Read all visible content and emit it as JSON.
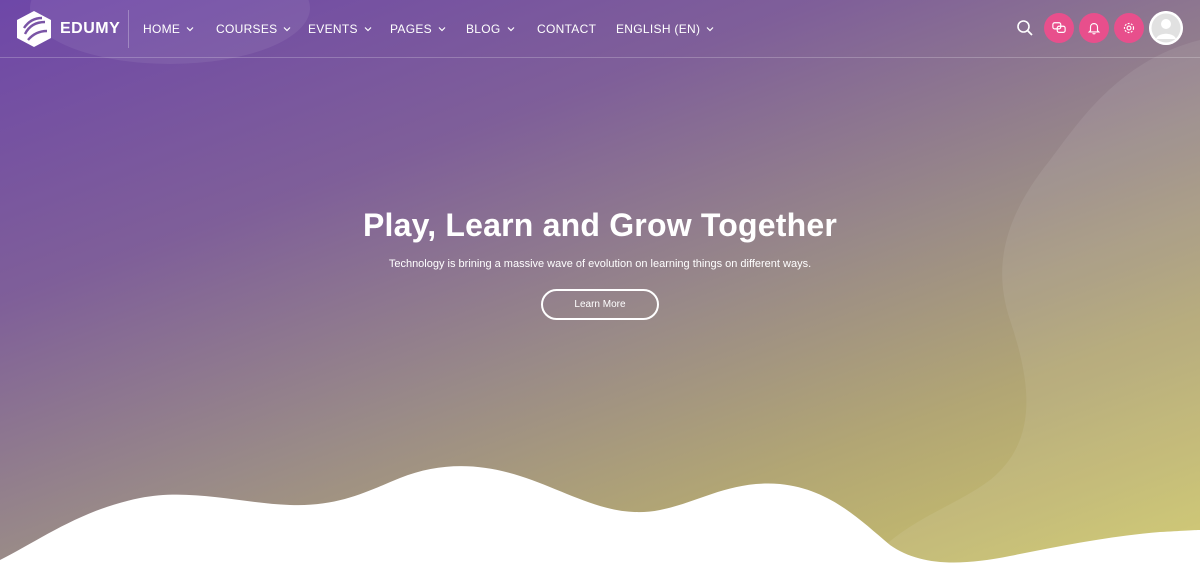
{
  "brand": {
    "name": "EDUMY"
  },
  "nav": {
    "items": [
      {
        "label": "HOME",
        "has_dropdown": true
      },
      {
        "label": "COURSES",
        "has_dropdown": true
      },
      {
        "label": "EVENTS",
        "has_dropdown": true
      },
      {
        "label": "PAGES",
        "has_dropdown": true
      },
      {
        "label": "BLOG",
        "has_dropdown": true
      },
      {
        "label": "CONTACT",
        "has_dropdown": false
      },
      {
        "label": "ENGLISH (EN)",
        "has_dropdown": true
      }
    ]
  },
  "header_icons": {
    "search": "search-icon",
    "buttons": [
      "chat-icon",
      "notification-icon",
      "settings-icon"
    ],
    "avatar": "user-avatar-icon"
  },
  "hero": {
    "title": "Play, Learn and Grow Together",
    "subtitle": "Technology is brining a massive wave of evolution on learning things on different ways.",
    "cta_label": "Learn More"
  },
  "colors": {
    "gradient_start": "#6e47a8",
    "gradient_end": "#cfc86a",
    "accent": "#e84f8c",
    "text": "#ffffff"
  }
}
